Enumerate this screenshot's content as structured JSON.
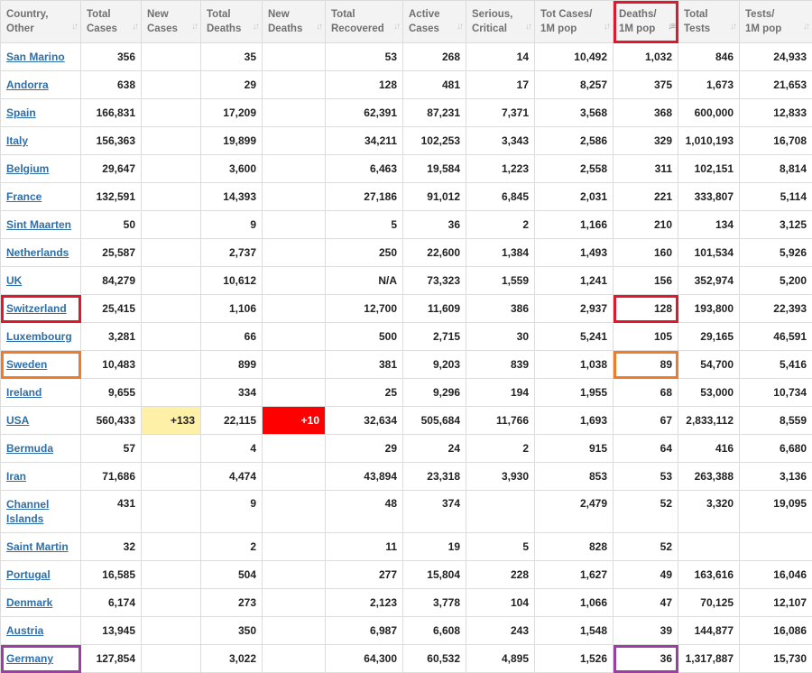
{
  "columns": [
    {
      "label": "Country,\nOther",
      "sort_icon": "sort-arrows-icon"
    },
    {
      "label": "Total\nCases",
      "sort_icon": "sort-arrows-icon"
    },
    {
      "label": "New\nCases",
      "sort_icon": "sort-arrows-icon"
    },
    {
      "label": "Total\nDeaths",
      "sort_icon": "sort-arrows-icon"
    },
    {
      "label": "New\nDeaths",
      "sort_icon": "sort-arrows-icon"
    },
    {
      "label": "Total\nRecovered",
      "sort_icon": "sort-arrows-icon"
    },
    {
      "label": "Active\nCases",
      "sort_icon": "sort-arrows-icon"
    },
    {
      "label": "Serious,\nCritical",
      "sort_icon": "sort-arrows-icon"
    },
    {
      "label": "Tot Cases/\n1M pop",
      "sort_icon": "sort-arrows-icon"
    },
    {
      "label": "Deaths/\n1M pop",
      "sort_icon": "sort-descending-icon",
      "sorted": true
    },
    {
      "label": "Total\nTests",
      "sort_icon": "sort-arrows-icon"
    },
    {
      "label": "Tests/\n1M pop",
      "sort_icon": "sort-arrows-icon"
    }
  ],
  "rows": [
    {
      "country": "San Marino",
      "total_cases": "356",
      "new_cases": "",
      "total_deaths": "35",
      "new_deaths": "",
      "total_recovered": "53",
      "active_cases": "268",
      "serious_critical": "14",
      "tot_cases_per_1m": "10,492",
      "deaths_per_1m": "1,032",
      "total_tests": "846",
      "tests_per_1m": "24,933"
    },
    {
      "country": "Andorra",
      "total_cases": "638",
      "new_cases": "",
      "total_deaths": "29",
      "new_deaths": "",
      "total_recovered": "128",
      "active_cases": "481",
      "serious_critical": "17",
      "tot_cases_per_1m": "8,257",
      "deaths_per_1m": "375",
      "total_tests": "1,673",
      "tests_per_1m": "21,653"
    },
    {
      "country": "Spain",
      "total_cases": "166,831",
      "new_cases": "",
      "total_deaths": "17,209",
      "new_deaths": "",
      "total_recovered": "62,391",
      "active_cases": "87,231",
      "serious_critical": "7,371",
      "tot_cases_per_1m": "3,568",
      "deaths_per_1m": "368",
      "total_tests": "600,000",
      "tests_per_1m": "12,833"
    },
    {
      "country": "Italy",
      "total_cases": "156,363",
      "new_cases": "",
      "total_deaths": "19,899",
      "new_deaths": "",
      "total_recovered": "34,211",
      "active_cases": "102,253",
      "serious_critical": "3,343",
      "tot_cases_per_1m": "2,586",
      "deaths_per_1m": "329",
      "total_tests": "1,010,193",
      "tests_per_1m": "16,708"
    },
    {
      "country": "Belgium",
      "total_cases": "29,647",
      "new_cases": "",
      "total_deaths": "3,600",
      "new_deaths": "",
      "total_recovered": "6,463",
      "active_cases": "19,584",
      "serious_critical": "1,223",
      "tot_cases_per_1m": "2,558",
      "deaths_per_1m": "311",
      "total_tests": "102,151",
      "tests_per_1m": "8,814"
    },
    {
      "country": "France",
      "total_cases": "132,591",
      "new_cases": "",
      "total_deaths": "14,393",
      "new_deaths": "",
      "total_recovered": "27,186",
      "active_cases": "91,012",
      "serious_critical": "6,845",
      "tot_cases_per_1m": "2,031",
      "deaths_per_1m": "221",
      "total_tests": "333,807",
      "tests_per_1m": "5,114"
    },
    {
      "country": "Sint Maarten",
      "total_cases": "50",
      "new_cases": "",
      "total_deaths": "9",
      "new_deaths": "",
      "total_recovered": "5",
      "active_cases": "36",
      "serious_critical": "2",
      "tot_cases_per_1m": "1,166",
      "deaths_per_1m": "210",
      "total_tests": "134",
      "tests_per_1m": "3,125"
    },
    {
      "country": "Netherlands",
      "total_cases": "25,587",
      "new_cases": "",
      "total_deaths": "2,737",
      "new_deaths": "",
      "total_recovered": "250",
      "active_cases": "22,600",
      "serious_critical": "1,384",
      "tot_cases_per_1m": "1,493",
      "deaths_per_1m": "160",
      "total_tests": "101,534",
      "tests_per_1m": "5,926"
    },
    {
      "country": "UK",
      "total_cases": "84,279",
      "new_cases": "",
      "total_deaths": "10,612",
      "new_deaths": "",
      "total_recovered": "N/A",
      "active_cases": "73,323",
      "serious_critical": "1,559",
      "tot_cases_per_1m": "1,241",
      "deaths_per_1m": "156",
      "total_tests": "352,974",
      "tests_per_1m": "5,200"
    },
    {
      "country": "Switzerland",
      "total_cases": "25,415",
      "new_cases": "",
      "total_deaths": "1,106",
      "new_deaths": "",
      "total_recovered": "12,700",
      "active_cases": "11,609",
      "serious_critical": "386",
      "tot_cases_per_1m": "2,937",
      "deaths_per_1m": "128",
      "total_tests": "193,800",
      "tests_per_1m": "22,393"
    },
    {
      "country": "Luxembourg",
      "total_cases": "3,281",
      "new_cases": "",
      "total_deaths": "66",
      "new_deaths": "",
      "total_recovered": "500",
      "active_cases": "2,715",
      "serious_critical": "30",
      "tot_cases_per_1m": "5,241",
      "deaths_per_1m": "105",
      "total_tests": "29,165",
      "tests_per_1m": "46,591"
    },
    {
      "country": "Sweden",
      "total_cases": "10,483",
      "new_cases": "",
      "total_deaths": "899",
      "new_deaths": "",
      "total_recovered": "381",
      "active_cases": "9,203",
      "serious_critical": "839",
      "tot_cases_per_1m": "1,038",
      "deaths_per_1m": "89",
      "total_tests": "54,700",
      "tests_per_1m": "5,416"
    },
    {
      "country": "Ireland",
      "total_cases": "9,655",
      "new_cases": "",
      "total_deaths": "334",
      "new_deaths": "",
      "total_recovered": "25",
      "active_cases": "9,296",
      "serious_critical": "194",
      "tot_cases_per_1m": "1,955",
      "deaths_per_1m": "68",
      "total_tests": "53,000",
      "tests_per_1m": "10,734"
    },
    {
      "country": "USA",
      "total_cases": "560,433",
      "new_cases": "+133",
      "total_deaths": "22,115",
      "new_deaths": "+10",
      "total_recovered": "32,634",
      "active_cases": "505,684",
      "serious_critical": "11,766",
      "tot_cases_per_1m": "1,693",
      "deaths_per_1m": "67",
      "total_tests": "2,833,112",
      "tests_per_1m": "8,559"
    },
    {
      "country": "Bermuda",
      "total_cases": "57",
      "new_cases": "",
      "total_deaths": "4",
      "new_deaths": "",
      "total_recovered": "29",
      "active_cases": "24",
      "serious_critical": "2",
      "tot_cases_per_1m": "915",
      "deaths_per_1m": "64",
      "total_tests": "416",
      "tests_per_1m": "6,680"
    },
    {
      "country": "Iran",
      "total_cases": "71,686",
      "new_cases": "",
      "total_deaths": "4,474",
      "new_deaths": "",
      "total_recovered": "43,894",
      "active_cases": "23,318",
      "serious_critical": "3,930",
      "tot_cases_per_1m": "853",
      "deaths_per_1m": "53",
      "total_tests": "263,388",
      "tests_per_1m": "3,136"
    },
    {
      "country": "Channel Islands",
      "total_cases": "431",
      "new_cases": "",
      "total_deaths": "9",
      "new_deaths": "",
      "total_recovered": "48",
      "active_cases": "374",
      "serious_critical": "",
      "tot_cases_per_1m": "2,479",
      "deaths_per_1m": "52",
      "total_tests": "3,320",
      "tests_per_1m": "19,095"
    },
    {
      "country": "Saint Martin",
      "total_cases": "32",
      "new_cases": "",
      "total_deaths": "2",
      "new_deaths": "",
      "total_recovered": "11",
      "active_cases": "19",
      "serious_critical": "5",
      "tot_cases_per_1m": "828",
      "deaths_per_1m": "52",
      "total_tests": "",
      "tests_per_1m": ""
    },
    {
      "country": "Portugal",
      "total_cases": "16,585",
      "new_cases": "",
      "total_deaths": "504",
      "new_deaths": "",
      "total_recovered": "277",
      "active_cases": "15,804",
      "serious_critical": "228",
      "tot_cases_per_1m": "1,627",
      "deaths_per_1m": "49",
      "total_tests": "163,616",
      "tests_per_1m": "16,046"
    },
    {
      "country": "Denmark",
      "total_cases": "6,174",
      "new_cases": "",
      "total_deaths": "273",
      "new_deaths": "",
      "total_recovered": "2,123",
      "active_cases": "3,778",
      "serious_critical": "104",
      "tot_cases_per_1m": "1,066",
      "deaths_per_1m": "47",
      "total_tests": "70,125",
      "tests_per_1m": "12,107"
    },
    {
      "country": "Austria",
      "total_cases": "13,945",
      "new_cases": "",
      "total_deaths": "350",
      "new_deaths": "",
      "total_recovered": "6,987",
      "active_cases": "6,608",
      "serious_critical": "243",
      "tot_cases_per_1m": "1,548",
      "deaths_per_1m": "39",
      "total_tests": "144,877",
      "tests_per_1m": "16,086"
    },
    {
      "country": "Germany",
      "total_cases": "127,854",
      "new_cases": "",
      "total_deaths": "3,022",
      "new_deaths": "",
      "total_recovered": "64,300",
      "active_cases": "60,532",
      "serious_critical": "4,895",
      "tot_cases_per_1m": "1,526",
      "deaths_per_1m": "36",
      "total_tests": "1,317,887",
      "tests_per_1m": "15,730"
    }
  ],
  "colors": {
    "link": "#2f6fa6",
    "new_cases_highlight": "#fff0a8",
    "new_deaths_highlight": "#ff0000",
    "annotation_red": "#e0182d",
    "annotation_orange": "#f07c2a",
    "annotation_purple": "#9b3fa3"
  }
}
